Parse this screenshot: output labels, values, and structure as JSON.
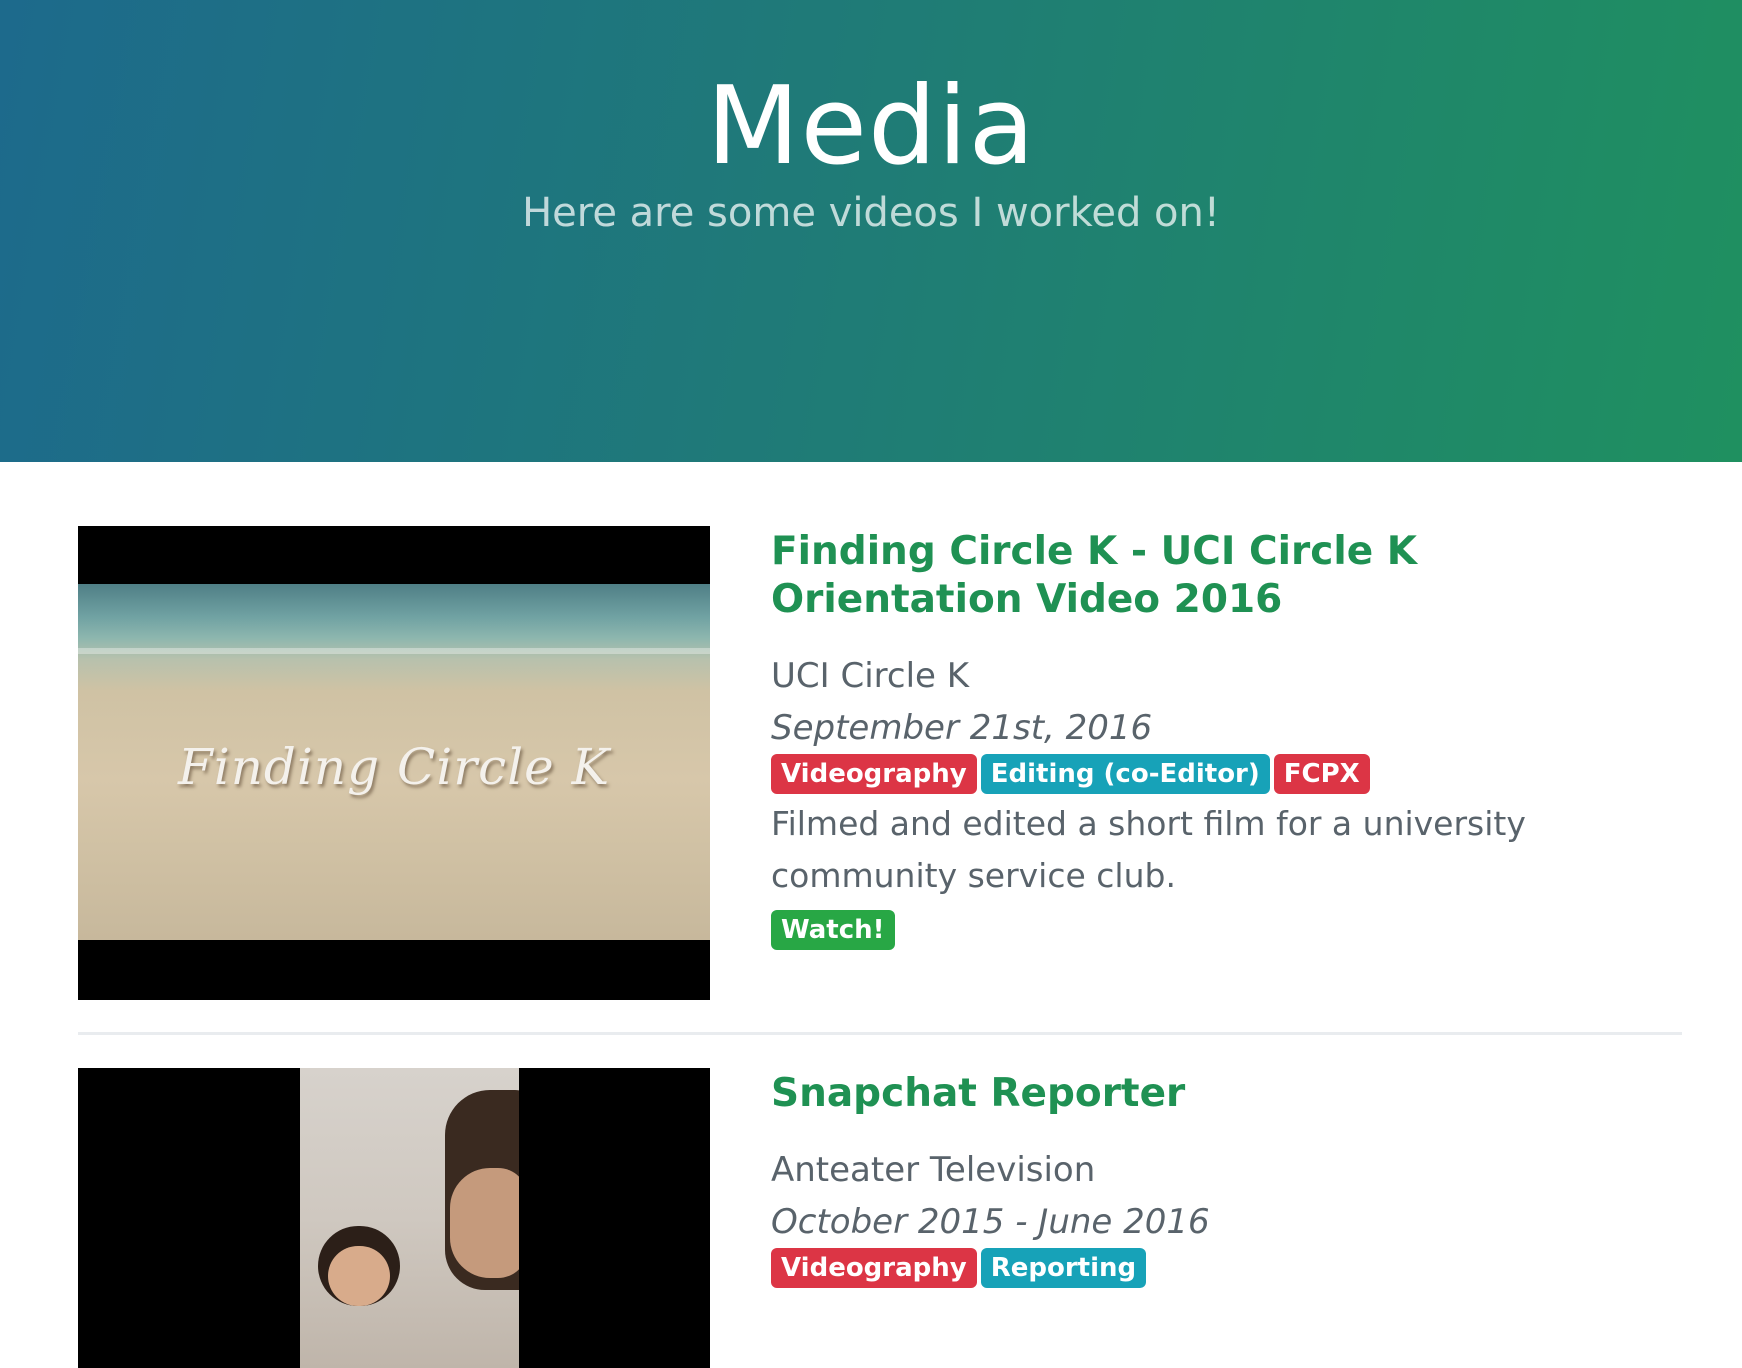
{
  "hero": {
    "title": "Media",
    "subtitle": "Here are some videos I worked on!"
  },
  "entries": [
    {
      "thumbnail_caption": "Finding Circle K",
      "title": "Finding Circle K - UCI Circle K Orientation Video 2016",
      "org": "UCI Circle K",
      "date": "September 21st, 2016",
      "tags": [
        {
          "label": "Videography",
          "color": "#dc3545"
        },
        {
          "label": "Editing (co-Editor)",
          "color": "#17a2b8"
        },
        {
          "label": "FCPX",
          "color": "#dc3545"
        }
      ],
      "description": "Filmed and edited a short film for a university community service club.",
      "watch_label": "Watch!"
    },
    {
      "title": "Snapchat Reporter",
      "org": "Anteater Television",
      "date": "October 2015 - June 2016",
      "tags": [
        {
          "label": "Videography",
          "color": "#dc3545"
        },
        {
          "label": "Reporting",
          "color": "#17a2b8"
        }
      ]
    }
  ],
  "colors": {
    "accent": "#1f9153",
    "gradient_start": "#1d6a8c",
    "gradient_end": "#1f9060",
    "watch_button": "#28a745"
  }
}
